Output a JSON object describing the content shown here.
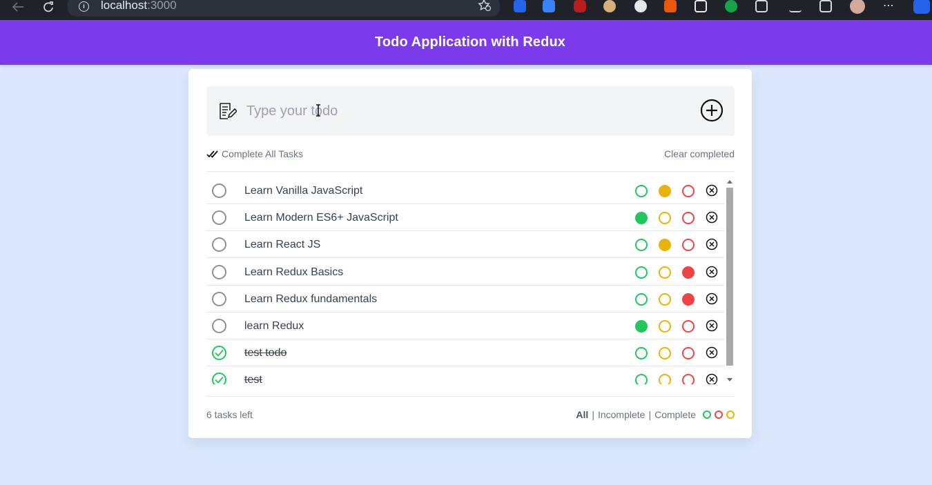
{
  "browser": {
    "url_host": "localhost",
    "url_port": ":3000",
    "more_label": "⋯"
  },
  "header": {
    "title": "Todo Application with Redux"
  },
  "input": {
    "placeholder": "Type your todo",
    "value": ""
  },
  "actions": {
    "complete_all_label": "Complete All Tasks",
    "clear_completed_label": "Clear completed"
  },
  "todos": [
    {
      "title": "Learn Vanilla JavaScript",
      "completed": false,
      "color": "yellow"
    },
    {
      "title": "Learn Modern ES6+ JavaScript",
      "completed": false,
      "color": "green"
    },
    {
      "title": "Learn React JS",
      "completed": false,
      "color": "yellow"
    },
    {
      "title": "Learn Redux Basics",
      "completed": false,
      "color": "red"
    },
    {
      "title": "Learn Redux fundamentals",
      "completed": false,
      "color": "red"
    },
    {
      "title": "learn Redux",
      "completed": false,
      "color": "green"
    },
    {
      "title": "test todo",
      "completed": true,
      "color": ""
    },
    {
      "title": "test",
      "completed": true,
      "color": ""
    }
  ],
  "footer": {
    "tasks_left": "6 tasks left",
    "filter_all": "All",
    "filter_incomplete": "Incomplete",
    "filter_complete": "Complete",
    "separator": "|",
    "active_filter": "All"
  },
  "colors": {
    "header_bg": "#7c3aed",
    "page_bg": "#dbe8fc",
    "green": "#22c55e",
    "yellow": "#eab308",
    "red": "#ef4444"
  }
}
